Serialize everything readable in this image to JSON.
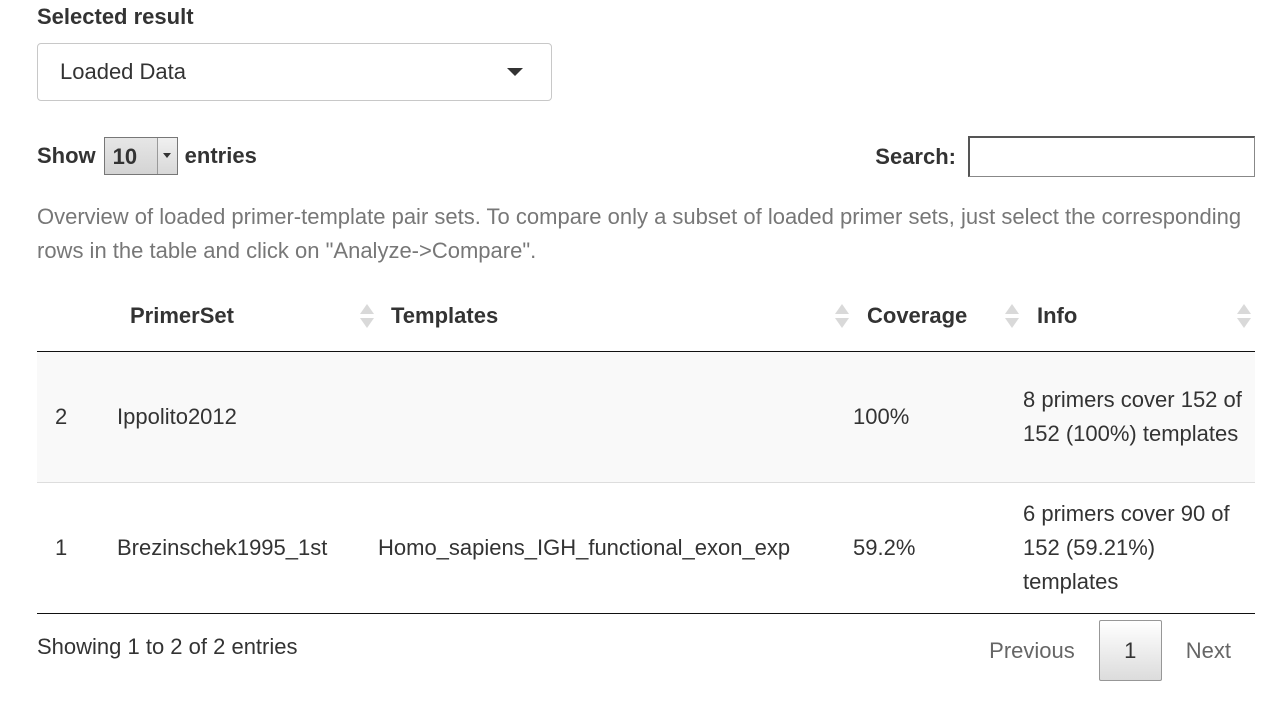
{
  "selected_result": {
    "label": "Selected result",
    "value": "Loaded Data"
  },
  "length_menu": {
    "prefix": "Show",
    "value": "10",
    "suffix": "entries"
  },
  "search": {
    "label": "Search:",
    "value": ""
  },
  "caption": "Overview of loaded primer-template pair sets. To compare only a subset of loaded primer sets, just select the corresponding rows in the table and click on \"Analyze->Compare\".",
  "table": {
    "columns": [
      "",
      "PrimerSet",
      "Templates",
      "Coverage",
      "Info"
    ],
    "rows": [
      {
        "id": "2",
        "primerset": "Ippolito2012",
        "templates": "",
        "coverage": "100%",
        "info": "8 primers cover 152 of 152 (100%) templates"
      },
      {
        "id": "1",
        "primerset": "Brezinschek1995_1st",
        "templates": "Homo_sapiens_IGH_functional_exon_exp",
        "coverage": "59.2%",
        "info": "6 primers cover 90 of 152 (59.21%) templates"
      }
    ]
  },
  "footer": {
    "info": "Showing 1 to 2 of 2 entries",
    "previous": "Previous",
    "current_page": "1",
    "next": "Next"
  },
  "icons": {
    "select_caret": "chevron-down-icon",
    "sort": "sort-both-icon"
  }
}
